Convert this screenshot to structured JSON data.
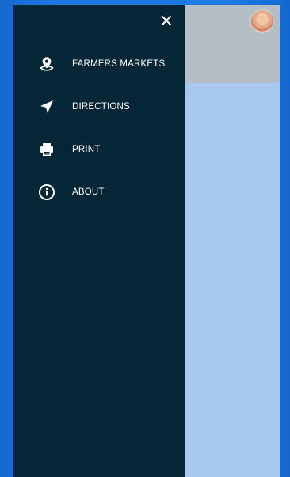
{
  "menu": {
    "items": [
      {
        "label": "FARMERS MARKETS",
        "icon": "map-pin-icon"
      },
      {
        "label": "DIRECTIONS",
        "icon": "navigation-arrow-icon"
      },
      {
        "label": "PRINT",
        "icon": "printer-icon"
      },
      {
        "label": "ABOUT",
        "icon": "info-icon"
      }
    ]
  },
  "drawer": {
    "close_icon": "close-icon"
  },
  "header": {
    "avatar": "user-avatar"
  },
  "colors": {
    "drawer_background": "#042636",
    "page_background": "#1d79e4",
    "map_background": "#a8c8ef",
    "header_background": "#b3bec5",
    "menu_text": "#ffffff"
  }
}
